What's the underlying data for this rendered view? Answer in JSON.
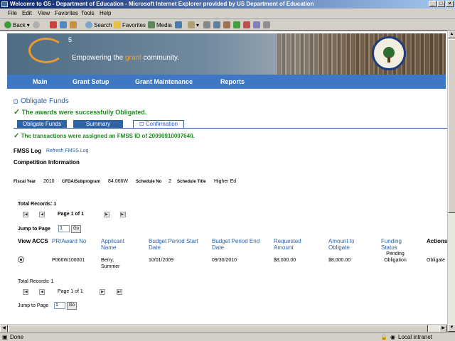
{
  "window": {
    "title": "Welcome to G5 - Department of Education - Microsoft Internet Explorer provided by US Department of Education",
    "buttons": [
      "_",
      "□",
      "×"
    ]
  },
  "menu": [
    "File",
    "Edit",
    "View",
    "Favorites",
    "Tools",
    "Help"
  ],
  "toolbar": {
    "back": "Back",
    "search": "Search",
    "favorites": "Favorites",
    "media": "Media"
  },
  "banner": {
    "logo_sup": "5",
    "tagline_pre": "Empowering the ",
    "tagline_hl": "grant",
    "tagline_post": " community."
  },
  "nav": [
    "Main",
    "Grant Setup",
    "Grant Maintenance",
    "Reports"
  ],
  "page": {
    "title": "Obligate Funds",
    "success_msg": "The awards were successfully Obligated.",
    "tabs": [
      "Obligate Funds",
      "Summary",
      "Confirmation"
    ],
    "fmss_msg": "The transactions were assigned an FMSS ID of 20090910007640.",
    "fmss_log_label": "FMSS Log",
    "refresh_link": "Refresh FMSS Log",
    "competition_info": "Competition Information",
    "fiscal_year_label": "Fiscal Year",
    "fiscal_year": "2010",
    "cfda_label": "CFDA/Subprogram",
    "cfda": "84.066W",
    "schedule_no_label": "Schedule No",
    "schedule_no": "2",
    "schedule_title_label": "Schedule Title",
    "schedule_title": "Higher Ed",
    "total_records_top": "Total Records: 1",
    "page_info_top": "Page 1 of 1",
    "jump_label_top": "Jump to Page",
    "jump_value_top": "1",
    "go_label": "Go",
    "total_records_bottom": "Total Records: 1",
    "page_info_bottom": "Page 1 of 1",
    "jump_label_bottom": "Jump to Page",
    "jump_value_bottom": "1"
  },
  "table": {
    "headers": [
      "View ACCS",
      "PR/Award No",
      "Applicant Name",
      "Budget Period Start Date",
      "Budget Period End Date",
      "Requested Amount",
      "Amount to Obligate",
      "Funding Status",
      "Actions"
    ],
    "row": {
      "award_no": "P066W100001",
      "applicant": "Berry, Summer",
      "start": "10/01/2009",
      "end": "09/30/2010",
      "requested": "$8,000.00",
      "obligate": "$8,000.00",
      "status": "Pending Obligation",
      "action": "Obligate"
    }
  },
  "statusbar": {
    "left": "Done",
    "zone": "Local intranet"
  },
  "colors": {
    "nav_blue": "#3e78c4",
    "success_green": "#1f8a1f",
    "link_blue": "#2a62a8"
  }
}
